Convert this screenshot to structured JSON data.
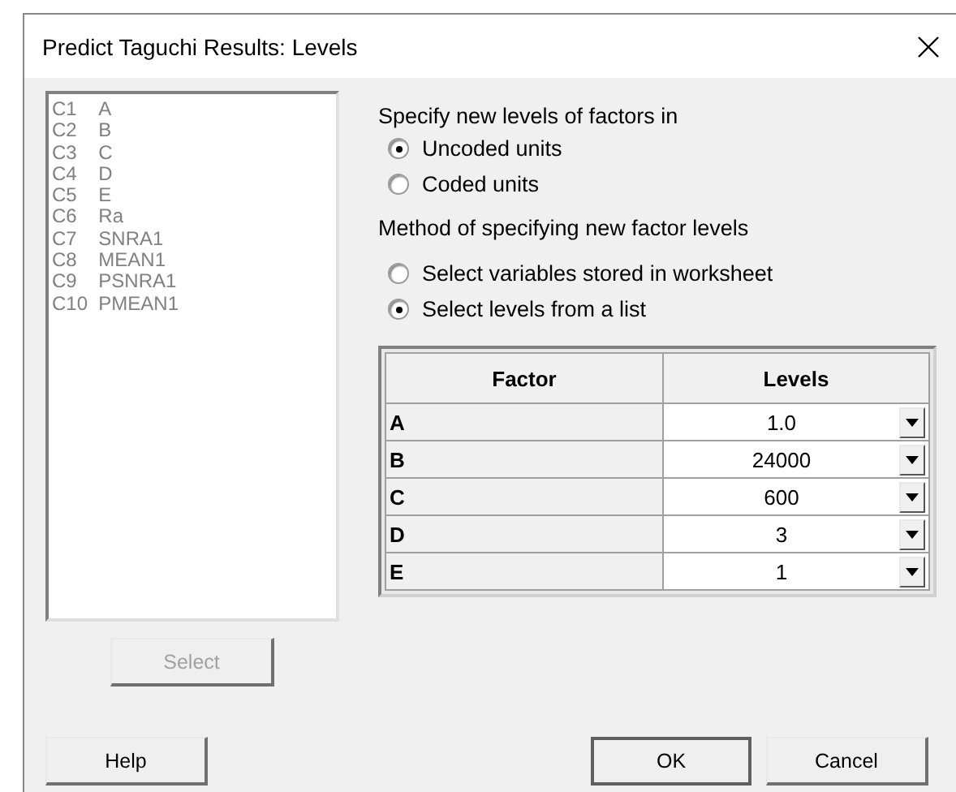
{
  "window": {
    "title": "Predict Taguchi Results: Levels"
  },
  "columns_list": [
    {
      "id": "C1",
      "name": "A"
    },
    {
      "id": "C2",
      "name": "B"
    },
    {
      "id": "C3",
      "name": "C"
    },
    {
      "id": "C4",
      "name": "D"
    },
    {
      "id": "C5",
      "name": "E"
    },
    {
      "id": "C6",
      "name": "Ra"
    },
    {
      "id": "C7",
      "name": "SNRA1"
    },
    {
      "id": "C8",
      "name": "MEAN1"
    },
    {
      "id": "C9",
      "name": "PSNRA1"
    },
    {
      "id": "C10",
      "name": "PMEAN1"
    }
  ],
  "select_button": {
    "label": "Select",
    "disabled": true
  },
  "units": {
    "label": "Specify new levels of factors in",
    "options": [
      {
        "label": "Uncoded units",
        "selected": true
      },
      {
        "label": "Coded units",
        "selected": false
      }
    ]
  },
  "method": {
    "label": "Method of specifying new factor levels",
    "options": [
      {
        "label": "Select variables stored in worksheet",
        "selected": false
      },
      {
        "label": "Select levels from a list",
        "selected": true
      }
    ]
  },
  "table": {
    "columns": [
      "Factor",
      "Levels"
    ],
    "rows": [
      {
        "factor": "A",
        "level": "1.0"
      },
      {
        "factor": "B",
        "level": "24000"
      },
      {
        "factor": "C",
        "level": "600"
      },
      {
        "factor": "D",
        "level": "3"
      },
      {
        "factor": "E",
        "level": "1"
      }
    ]
  },
  "buttons": [
    {
      "label": "Help",
      "default": false
    },
    {
      "label": "OK",
      "default": true
    },
    {
      "label": "Cancel",
      "default": false
    }
  ]
}
